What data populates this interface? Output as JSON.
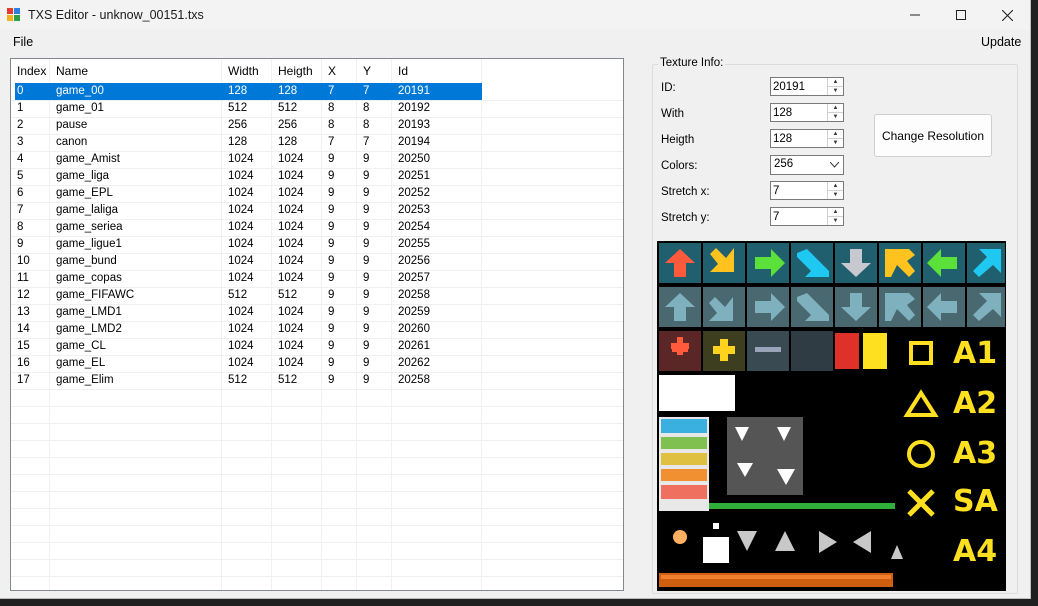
{
  "window": {
    "title": "TXS Editor - unknow_00151.txs"
  },
  "menu": {
    "file": "File",
    "update": "Update"
  },
  "list": {
    "columns": [
      "Index",
      "Name",
      "Width",
      "Heigth",
      "X",
      "Y",
      "Id"
    ],
    "rows": [
      [
        "0",
        "game_00",
        "128",
        "128",
        "7",
        "7",
        "20191"
      ],
      [
        "1",
        "game_01",
        "512",
        "512",
        "8",
        "8",
        "20192"
      ],
      [
        "2",
        "pause",
        "256",
        "256",
        "8",
        "8",
        "20193"
      ],
      [
        "3",
        "canon",
        "128",
        "128",
        "7",
        "7",
        "20194"
      ],
      [
        "4",
        "game_Amist",
        "1024",
        "1024",
        "9",
        "9",
        "20250"
      ],
      [
        "5",
        "game_liga",
        "1024",
        "1024",
        "9",
        "9",
        "20251"
      ],
      [
        "6",
        "game_EPL",
        "1024",
        "1024",
        "9",
        "9",
        "20252"
      ],
      [
        "7",
        "game_laliga",
        "1024",
        "1024",
        "9",
        "9",
        "20253"
      ],
      [
        "8",
        "game_seriea",
        "1024",
        "1024",
        "9",
        "9",
        "20254"
      ],
      [
        "9",
        "game_ligue1",
        "1024",
        "1024",
        "9",
        "9",
        "20255"
      ],
      [
        "10",
        "game_bund",
        "1024",
        "1024",
        "9",
        "9",
        "20256"
      ],
      [
        "11",
        "game_copas",
        "1024",
        "1024",
        "9",
        "9",
        "20257"
      ],
      [
        "12",
        "game_FIFAWC",
        "512",
        "512",
        "9",
        "9",
        "20258"
      ],
      [
        "13",
        "game_LMD1",
        "1024",
        "1024",
        "9",
        "9",
        "20259"
      ],
      [
        "14",
        "game_LMD2",
        "1024",
        "1024",
        "9",
        "9",
        "20260"
      ],
      [
        "15",
        "game_CL",
        "1024",
        "1024",
        "9",
        "9",
        "20261"
      ],
      [
        "16",
        "game_EL",
        "1024",
        "1024",
        "9",
        "9",
        "20262"
      ],
      [
        "17",
        "game_Elim",
        "512",
        "512",
        "9",
        "9",
        "20258"
      ]
    ],
    "selected_index": 0
  },
  "texture_info": {
    "title": "Texture Info:",
    "id_label": "ID:",
    "id_value": "20191",
    "width_label": "With",
    "width_value": "128",
    "height_label": "Heigth",
    "height_value": "128",
    "colors_label": "Colors:",
    "colors_value": "256",
    "stretch_x_label": "Stretch x:",
    "stretch_x_value": "7",
    "stretch_y_label": "Stretch y:",
    "stretch_y_value": "7",
    "change_button": "Change Resolution"
  },
  "preview": {
    "labels": [
      "A1",
      "A2",
      "A3",
      "SA",
      "A4"
    ]
  },
  "colors": {
    "selection": "#0078d7",
    "tile_bg": "#1f5f6e",
    "arrow_red": "#ff5a3c",
    "arrow_yellow": "#ffc21e",
    "arrow_green": "#5ce03a",
    "arrow_cyan": "#1fc8f0",
    "arrow_gray": "#c8c8d0",
    "symbol_yellow": "#ffe020"
  }
}
